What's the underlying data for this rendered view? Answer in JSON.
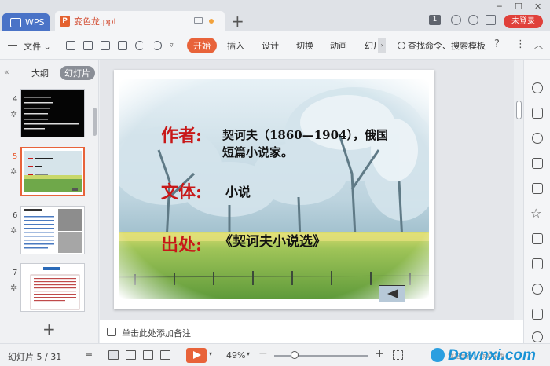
{
  "titlebar": {
    "home_tab": "WPS",
    "file_tab": "变色龙.ppt",
    "file_icon": "P",
    "badge": "1",
    "login": "未登录"
  },
  "ribbon": {
    "file_menu": "文件",
    "tabs": [
      "开始",
      "插入",
      "设计",
      "切换",
      "动画",
      "幻片"
    ],
    "active_tab": "开始",
    "search": "查找命令、搜索模板",
    "help": "?"
  },
  "left_panel": {
    "tabs": [
      "大纲",
      "幻灯片"
    ],
    "active_tab": "幻灯片",
    "thumbnails": [
      {
        "num": "4"
      },
      {
        "num": "5"
      },
      {
        "num": "6"
      },
      {
        "num": "7"
      }
    ],
    "add": "+"
  },
  "slide": {
    "author_label": "作者:",
    "author_text_line1": "契诃夫（1860—1904），俄国",
    "author_text_line2": "短篇小说家。",
    "genre_label": "文体:",
    "genre_text": "小说",
    "source_label": "出处:",
    "source_text": "《契诃夫小说选》"
  },
  "notes": {
    "placeholder": "单击此处添加备注"
  },
  "statusbar": {
    "slide_counter": "幻灯片 5 / 31",
    "zoom": "49%",
    "minus": "−",
    "plus": "+",
    "watermark": "Downxi.com",
    "watermark_sub": "我是显行。你的东西"
  },
  "colors": {
    "accent": "#e8633a",
    "login": "#e0403a",
    "wps_tab": "#4a73c7",
    "slide_label": "#c81818"
  }
}
